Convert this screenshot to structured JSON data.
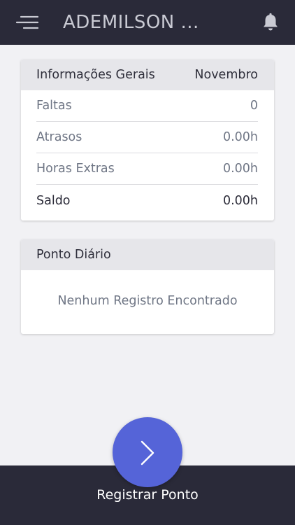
{
  "header": {
    "title": "ADEMILSON ...",
    "menu_icon": "menu-icon",
    "notification_icon": "bell-icon"
  },
  "info_card": {
    "title": "Informações Gerais",
    "month": "Novembro",
    "rows": [
      {
        "label": "Faltas",
        "value": "0"
      },
      {
        "label": "Atrasos",
        "value": "0.00h"
      },
      {
        "label": "Horas Extras",
        "value": "0.00h"
      },
      {
        "label": "Saldo",
        "value": "0.00h"
      }
    ]
  },
  "daily_card": {
    "title": "Ponto Diário",
    "empty_message": "Nenhum Registro Encontrado"
  },
  "footer": {
    "register_label": "Registrar Ponto",
    "fab_icon": "chevron-right-icon"
  },
  "colors": {
    "bar_background": "#2a2a39",
    "page_background": "#f1f1f4",
    "card_header": "#e6e6ea",
    "accent": "#5564d8"
  }
}
